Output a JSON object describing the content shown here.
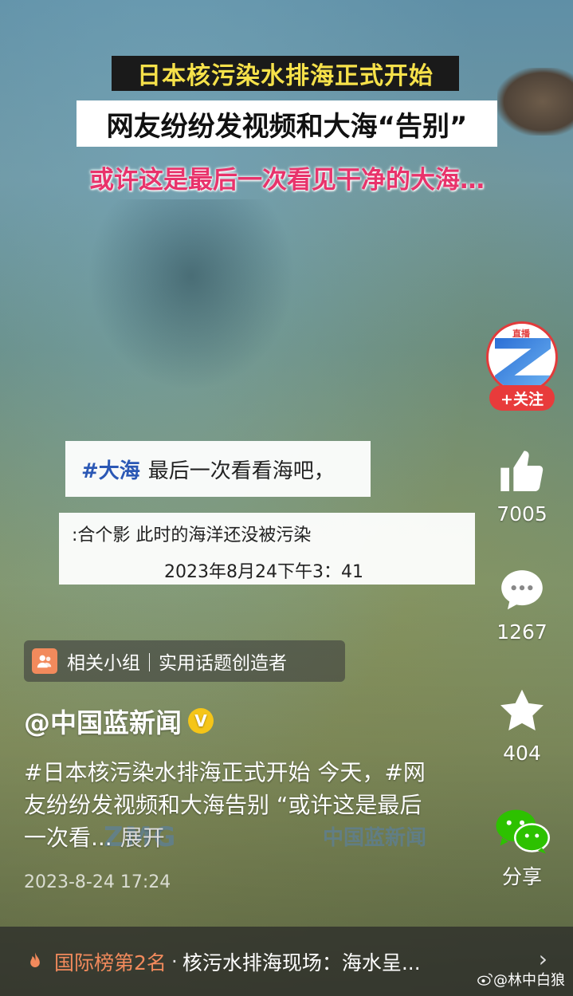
{
  "video_overlay": {
    "title_line1": "日本核污染水排海正式开始",
    "title_line2": "网友纷纷发视频和大海“告别”",
    "title_line3": "或许这是最后一次看见干净的大海…",
    "caption_card1_tag": "#大海",
    "caption_card1_text": "最后一次看看海吧，",
    "caption_card2_line1": ":合个影  此时的海洋还没被污染",
    "caption_card2_line2": "2023年8月24下午3：41"
  },
  "related_group": {
    "label": "相关小组｜实用话题创造者",
    "icon": "group-icon"
  },
  "post": {
    "author": "@中国蓝新闻",
    "verified_badge": "V",
    "description": "#日本核污染水排海正式开始 今天，#网友纷纷发视频和大海告别 “或许这是最后一次看...",
    "more_label": "展开",
    "date": "2023-8-24 17:24"
  },
  "watermarks": {
    "left": "ZMG",
    "right": "中国蓝新闻"
  },
  "sidebar": {
    "avatar_live_label": "直播",
    "follow_label": "+关注",
    "like_count": "7005",
    "comment_count": "1267",
    "favorite_count": "404",
    "share_label": "分享"
  },
  "bottom_bar": {
    "rank": "国际榜第2名",
    "separator": "·",
    "news": "核污水排海现场：海水呈...",
    "chevron": "›"
  },
  "footer_watermark": "@林中白狼",
  "colors": {
    "title_yellow": "#f6e14a",
    "subtitle_pink": "#e8336b",
    "follow_red": "#e83b3b",
    "rank_orange": "#f28a5c",
    "hashtag_blue": "#2b58b5"
  }
}
